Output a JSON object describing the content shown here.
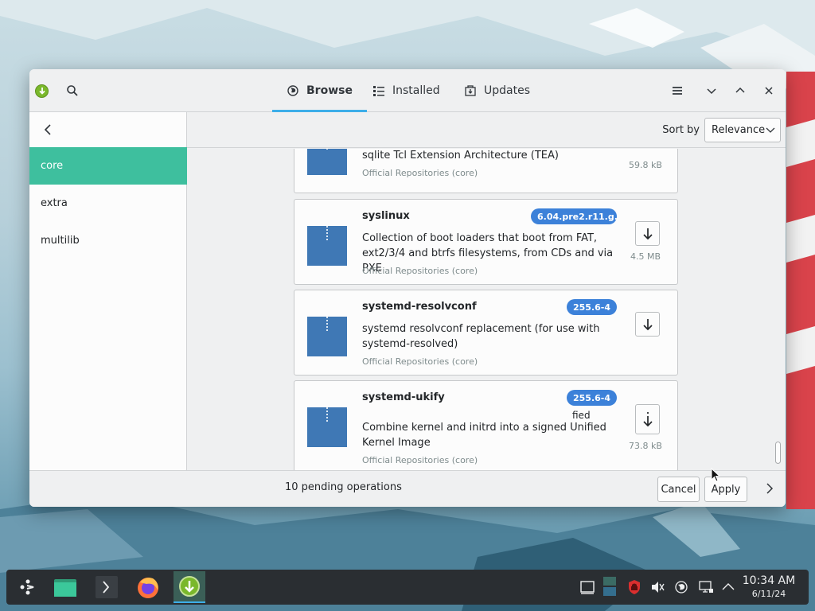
{
  "titlebar": {
    "tabs": [
      {
        "label": "Browse",
        "icon": "globe-icon",
        "active": true
      },
      {
        "label": "Installed",
        "icon": "list-icon",
        "active": false
      },
      {
        "label": "Updates",
        "icon": "updates-icon",
        "active": false
      }
    ]
  },
  "sidebar": {
    "items": [
      {
        "label": "core",
        "active": true
      },
      {
        "label": "extra",
        "active": false
      },
      {
        "label": "multilib",
        "active": false
      }
    ]
  },
  "sort": {
    "label": "Sort by",
    "value": "Relevance"
  },
  "packages": [
    {
      "name": "",
      "description": "sqlite Tcl Extension Architecture (TEA)",
      "repo": "Official Repositories (core)",
      "version": "",
      "size": "59.8 kB"
    },
    {
      "name": "syslinux",
      "description": "Collection of boot loaders that boot from FAT, ext2/3/4 and btrfs filesystems, from CDs and via PXE",
      "repo": "Official Repositories (core)",
      "version": "6.04.pre2.r11.g...",
      "size": "4.5 MB"
    },
    {
      "name": "systemd-resolvconf",
      "description": "systemd resolvconf replacement (for use with systemd-resolved)",
      "repo": "Official Repositories (core)",
      "version": "255.6-4",
      "size": ""
    },
    {
      "name": "systemd-ukify",
      "description": "Combine kernel and initrd into a signed Unified Kernel Image",
      "repo": "Official Repositories (core)",
      "version": "255.6-4",
      "size": "73.8 kB",
      "artifact": "fied"
    }
  ],
  "footer": {
    "pending": "10 pending operations",
    "cancel_label": "Cancel",
    "apply_label": "Apply"
  },
  "taskbar": {
    "time": "10:34 AM",
    "date": "6/11/24"
  },
  "colors": {
    "accent": "#3daee9",
    "selected_sidebar": "#3ebf9e",
    "version_badge": "#3c81d9",
    "package_icon": "#3f78b5"
  }
}
